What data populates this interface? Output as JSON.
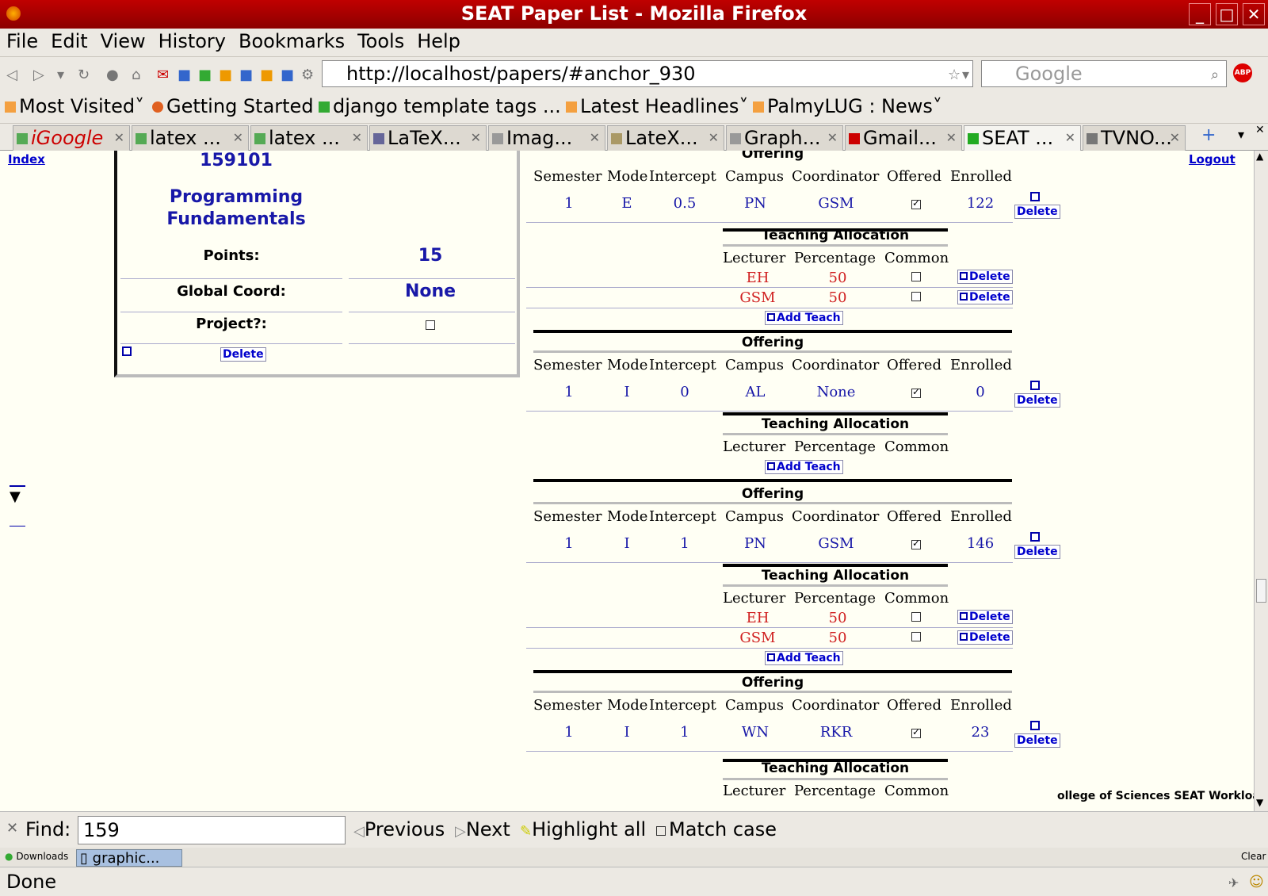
{
  "window": {
    "title": "SEAT Paper List - Mozilla Firefox"
  },
  "menu": [
    "File",
    "Edit",
    "View",
    "History",
    "Bookmarks",
    "Tools",
    "Help"
  ],
  "nav": {
    "url": "http://localhost/papers/#anchor_930",
    "search_placeholder": "Google"
  },
  "bookmarks": [
    "Most Visited˅",
    "Getting Started",
    "django template tags ...",
    "Latest Headlines˅",
    "PalmyLUG : News˅"
  ],
  "tabs": [
    "iGoogle",
    "latex ...",
    "latex ...",
    "LaTeX...",
    "Imag...",
    "LateX...",
    "Graph...",
    "Gmail...",
    "SEAT ...",
    "TVNO..."
  ],
  "page": {
    "index_link": "Index",
    "logout_link": "Logout",
    "paper": {
      "code": "159101",
      "name_line1": "Programming",
      "name_line2": "Fundamentals",
      "points_label": "Points:",
      "points_value": "15",
      "coord_label": "Global Coord:",
      "coord_value": "None",
      "project_label": "Project?:",
      "delete_label": "Delete"
    },
    "offering_title": "Offering",
    "teaching_title": "Teaching Allocation",
    "offering_headers": [
      "Semester",
      "Mode",
      "Intercept",
      "Campus",
      "Coordinator",
      "Offered",
      "Enrolled"
    ],
    "teaching_headers": [
      "Lecturer",
      "Percentage",
      "Common"
    ],
    "delete_label": "Delete",
    "add_teach_label": "Add Teach",
    "offerings": [
      {
        "semester": "1",
        "mode": "E",
        "intercept": "0.5",
        "campus": "PN",
        "coordinator": "GSM",
        "enrolled": "122",
        "offered": true
      },
      {
        "semester": "1",
        "mode": "I",
        "intercept": "0",
        "campus": "AL",
        "coordinator": "None",
        "enrolled": "0",
        "offered": true
      },
      {
        "semester": "1",
        "mode": "I",
        "intercept": "1",
        "campus": "PN",
        "coordinator": "GSM",
        "enrolled": "146",
        "offered": true
      },
      {
        "semester": "1",
        "mode": "I",
        "intercept": "1",
        "campus": "WN",
        "coordinator": "RKR",
        "enrolled": "23",
        "offered": true
      }
    ],
    "allocations": {
      "o1": [
        {
          "lecturer": "EH",
          "percentage": "50"
        },
        {
          "lecturer": "GSM",
          "percentage": "50"
        }
      ],
      "o3": [
        {
          "lecturer": "EH",
          "percentage": "50"
        },
        {
          "lecturer": "GSM",
          "percentage": "50"
        }
      ]
    },
    "footer_text": "ollege of Sciences SEAT Workload"
  },
  "find": {
    "label": "Find:",
    "value": "159",
    "previous": "Previous",
    "next": "Next",
    "highlight": "Highlight all",
    "match_case": "Match case"
  },
  "downloads": {
    "label": "Downloads",
    "item": "graphic...",
    "clear": "Clear"
  },
  "status": "Done"
}
